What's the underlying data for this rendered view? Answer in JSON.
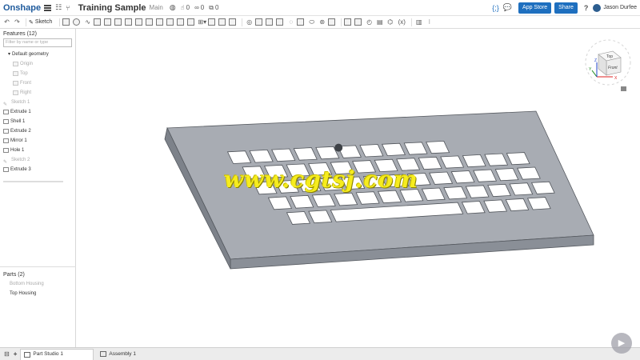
{
  "header": {
    "logo": "Onshape",
    "doc_title": "Training Sample",
    "branch": "Main",
    "likes": "0",
    "links": "0",
    "copies": "0",
    "app_store_label": "App Store",
    "share_label": "Share",
    "help_label": "?",
    "user_name": "Jason Durfee"
  },
  "toolbar": {
    "sketch_label": "Sketch"
  },
  "features": {
    "title": "Features (12)",
    "filter_placeholder": "Filter by name or type",
    "items": [
      {
        "label": "Default geometry",
        "muted": false,
        "indent": 1,
        "icon": "caret-down-icon"
      },
      {
        "label": "Origin",
        "muted": true,
        "indent": 2,
        "icon": "origin-icon"
      },
      {
        "label": "Top",
        "muted": true,
        "indent": 2,
        "icon": "plane-icon"
      },
      {
        "label": "Front",
        "muted": true,
        "indent": 2,
        "icon": "plane-icon"
      },
      {
        "label": "Right",
        "muted": true,
        "indent": 2,
        "icon": "plane-icon"
      },
      {
        "label": "Sketch 1",
        "muted": true,
        "indent": 0,
        "icon": "sketch-icon"
      },
      {
        "label": "Extrude 1",
        "muted": false,
        "indent": 0,
        "icon": "extrude-icon"
      },
      {
        "label": "Shell 1",
        "muted": false,
        "indent": 0,
        "icon": "shell-icon"
      },
      {
        "label": "Extrude 2",
        "muted": false,
        "indent": 0,
        "icon": "extrude-icon"
      },
      {
        "label": "Mirror 1",
        "muted": false,
        "indent": 0,
        "icon": "mirror-icon"
      },
      {
        "label": "Hole 1",
        "muted": false,
        "indent": 0,
        "icon": "hole-icon"
      },
      {
        "label": "Sketch 2",
        "muted": true,
        "indent": 0,
        "icon": "sketch-icon"
      },
      {
        "label": "Extrude 3",
        "muted": false,
        "indent": 0,
        "icon": "extrude-icon"
      }
    ]
  },
  "parts": {
    "title": "Parts (2)",
    "items": [
      {
        "label": "Bottom Housing",
        "active": false
      },
      {
        "label": "Top Housing",
        "active": true
      }
    ]
  },
  "viewcube": {
    "top_label": "Top",
    "front_label": "Front",
    "axis_x": "X",
    "axis_y": "Y",
    "axis_z": "Z"
  },
  "viewport": {
    "watermark": "www.cgtsj.com",
    "model_color": "#a7abb2"
  },
  "tabs": {
    "items": [
      {
        "label": "Part Studio 1",
        "active": true
      },
      {
        "label": "Assembly 1",
        "active": false
      }
    ]
  }
}
